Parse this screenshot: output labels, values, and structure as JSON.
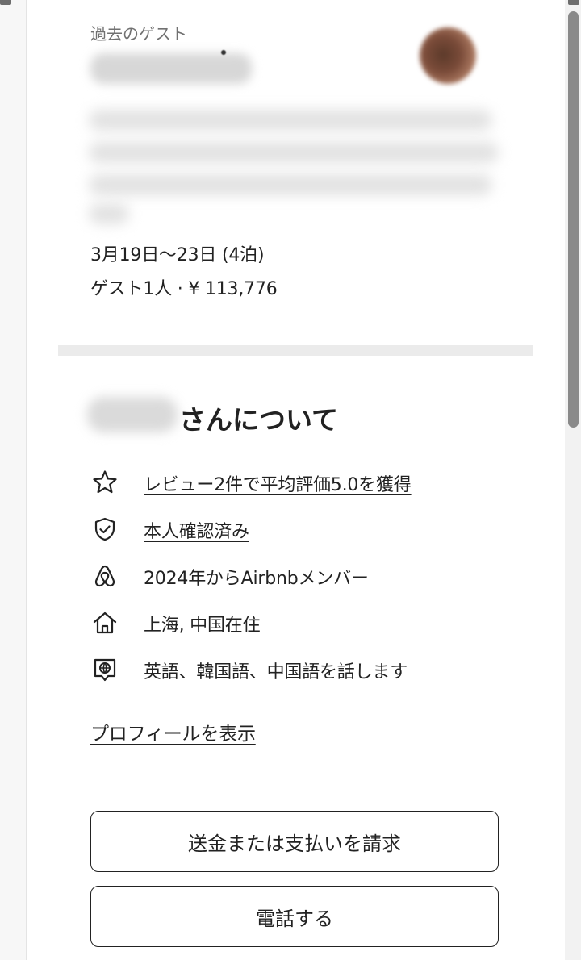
{
  "guest_card": {
    "label": "過去のゲスト",
    "dates": "3月19日〜23日 (4泊)",
    "guests_price": "ゲスト1人 · ¥ 113,776"
  },
  "about": {
    "title": "さんについて",
    "items": [
      {
        "icon": "star-icon",
        "text": "レビュー2件で平均評価5.0を獲得",
        "link": true
      },
      {
        "icon": "shield-check-icon",
        "text": "本人確認済み",
        "link": true
      },
      {
        "icon": "airbnb-logo-icon",
        "text": "2024年からAirbnbメンバー",
        "link": false
      },
      {
        "icon": "home-icon",
        "text": "上海, 中国在住",
        "link": false
      },
      {
        "icon": "globe-chat-icon",
        "text": "英語、韓国語、中国語を話します",
        "link": false
      }
    ],
    "profile_link": "プロフィールを表示"
  },
  "actions": {
    "request_payment": "送金または支払いを請求",
    "call": "電話する"
  }
}
